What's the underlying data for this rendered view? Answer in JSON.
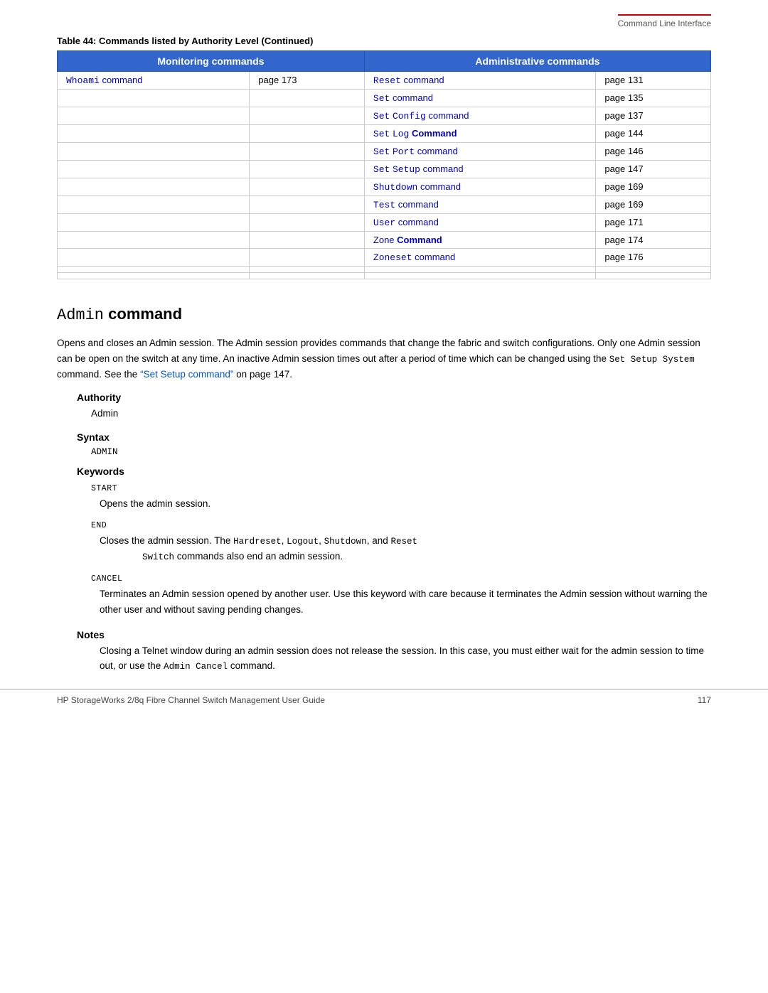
{
  "header": {
    "right_text": "Command Line Interface"
  },
  "table": {
    "caption": "Table 44:  Commands listed by Authority Level (Continued)",
    "col1_header": "Monitoring commands",
    "col2_header": "Administrative commands",
    "rows": [
      {
        "mon_cmd": "Whoami command",
        "mon_page": "page 173",
        "adm_cmd": "Reset command",
        "adm_page": "page 131"
      },
      {
        "mon_cmd": "",
        "mon_page": "",
        "adm_cmd": "Set command",
        "adm_page": "page 135"
      },
      {
        "mon_cmd": "",
        "mon_page": "",
        "adm_cmd": "Set Config command",
        "adm_page": "page 137"
      },
      {
        "mon_cmd": "",
        "mon_page": "",
        "adm_cmd": "Set Log Command",
        "adm_page": "page 144"
      },
      {
        "mon_cmd": "",
        "mon_page": "",
        "adm_cmd": "Set Port command",
        "adm_page": "page 146"
      },
      {
        "mon_cmd": "",
        "mon_page": "",
        "adm_cmd": "Set Setup command",
        "adm_page": "page 147"
      },
      {
        "mon_cmd": "",
        "mon_page": "",
        "adm_cmd": "Shutdown command",
        "adm_page": "page 169"
      },
      {
        "mon_cmd": "",
        "mon_page": "",
        "adm_cmd": "Test command",
        "adm_page": "page 169"
      },
      {
        "mon_cmd": "",
        "mon_page": "",
        "adm_cmd": "User command",
        "adm_page": "page 171"
      },
      {
        "mon_cmd": "",
        "mon_page": "",
        "adm_cmd": "Zone Command",
        "adm_page": "page 174"
      },
      {
        "mon_cmd": "",
        "mon_page": "",
        "adm_cmd": "Zoneset command",
        "adm_page": "page 176"
      },
      {
        "mon_cmd": "",
        "mon_page": "",
        "adm_cmd": "",
        "adm_page": ""
      },
      {
        "mon_cmd": "",
        "mon_page": "",
        "adm_cmd": "",
        "adm_page": ""
      }
    ]
  },
  "admin_section": {
    "title_mono": "Admin",
    "title_bold": "command",
    "body_text": "Opens and closes an Admin session. The Admin session provides commands that change the fabric and switch configurations. Only one Admin session can be open on the switch at any time. An inactive Admin session times out after a period of time which can be changed using the Set Setup System command. See the “Set Setup command” on page 147.",
    "link_text": "“Set Setup command”",
    "authority_heading": "Authority",
    "authority_value": "Admin",
    "syntax_heading": "Syntax",
    "syntax_code": "ADMIN",
    "keywords_heading": "Keywords",
    "keyword1_label": "START",
    "keyword1_desc": "Opens the admin session.",
    "keyword2_label": "END",
    "keyword2_desc1": "Closes the admin session. The ",
    "keyword2_inline": "Hardreset, Logout, Shutdown,",
    "keyword2_and": " and ",
    "keyword2_inline2": "Reset Switch",
    "keyword2_desc2": " commands also end an admin session.",
    "keyword3_label": "CANCEL",
    "keyword3_desc": "Terminates an Admin session opened by another user. Use this keyword with care because it terminates the Admin session without warning the other user and without saving pending changes.",
    "notes_heading": "Notes",
    "notes_text1": "Closing a Telnet window during an admin session does not release the session. In this case, you must either wait for the admin session to time out, or use the ",
    "notes_inline": "Admin Cancel",
    "notes_text2": " command."
  },
  "footer": {
    "left_text": "HP StorageWorks 2/8q Fibre Channel Switch Management User Guide",
    "right_text": "117"
  }
}
